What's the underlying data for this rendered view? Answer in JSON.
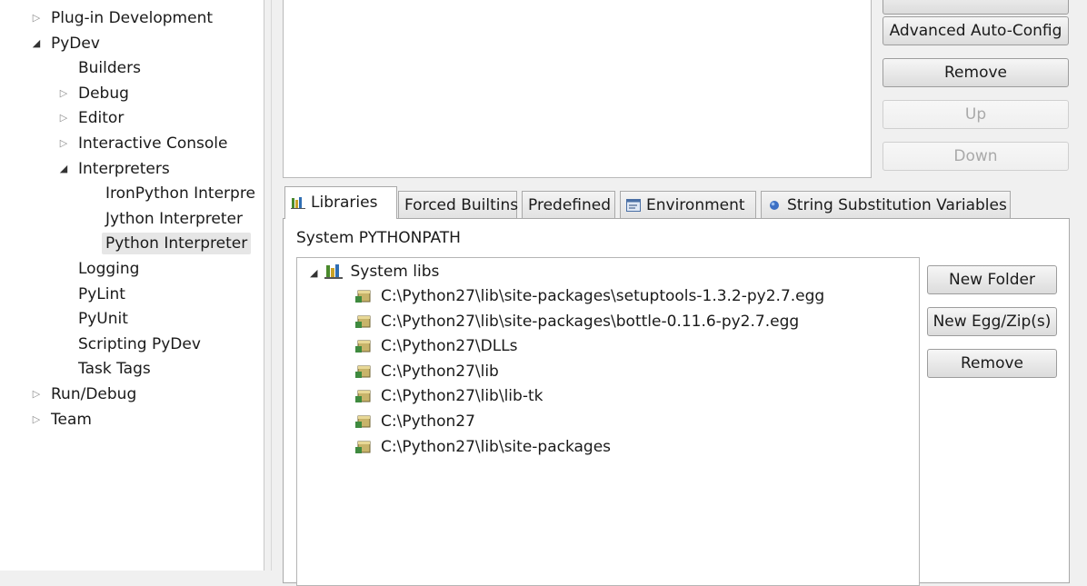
{
  "tree": {
    "items": [
      {
        "label": "Plug-in Development",
        "state": "collapsed"
      },
      {
        "label": "PyDev",
        "state": "expanded"
      },
      {
        "label": "Builders",
        "state": "leaf"
      },
      {
        "label": "Debug",
        "state": "collapsed"
      },
      {
        "label": "Editor",
        "state": "collapsed"
      },
      {
        "label": "Interactive Console",
        "state": "collapsed"
      },
      {
        "label": "Interpreters",
        "state": "expanded"
      },
      {
        "label": "IronPython Interpre",
        "state": "leaf"
      },
      {
        "label": "Jython Interpreter",
        "state": "leaf"
      },
      {
        "label": "Python Interpreter",
        "state": "leaf",
        "selected": true
      },
      {
        "label": "Logging",
        "state": "leaf"
      },
      {
        "label": "PyLint",
        "state": "leaf"
      },
      {
        "label": "PyUnit",
        "state": "leaf"
      },
      {
        "label": "Scripting PyDev",
        "state": "leaf"
      },
      {
        "label": "Task Tags",
        "state": "leaf"
      },
      {
        "label": "Run/Debug",
        "state": "collapsed"
      },
      {
        "label": "Team",
        "state": "collapsed"
      }
    ]
  },
  "interpreter_buttons": {
    "advanced": "Advanced Auto-Config",
    "remove": "Remove",
    "up": "Up",
    "down": "Down"
  },
  "tabs": [
    {
      "label": "Libraries",
      "icon": "libraries-icon",
      "active": true
    },
    {
      "label": "Forced Builtins",
      "icon": "",
      "active": false
    },
    {
      "label": "Predefined",
      "icon": "",
      "active": false
    },
    {
      "label": "Environment",
      "icon": "environment-icon",
      "active": false
    },
    {
      "label": "String Substitution Variables",
      "icon": "variables-icon",
      "active": false
    }
  ],
  "libraries": {
    "section_label": "System PYTHONPATH",
    "root_label": "System libs",
    "paths": [
      "C:\\Python27\\lib\\site-packages\\setuptools-1.3.2-py2.7.egg",
      "C:\\Python27\\lib\\site-packages\\bottle-0.11.6-py2.7.egg",
      "C:\\Python27\\DLLs",
      "C:\\Python27\\lib",
      "C:\\Python27\\lib\\lib-tk",
      "C:\\Python27",
      "C:\\Python27\\lib\\site-packages"
    ],
    "buttons": {
      "new_folder": "New Folder",
      "new_egg": "New Egg/Zip(s)",
      "remove": "Remove"
    }
  }
}
